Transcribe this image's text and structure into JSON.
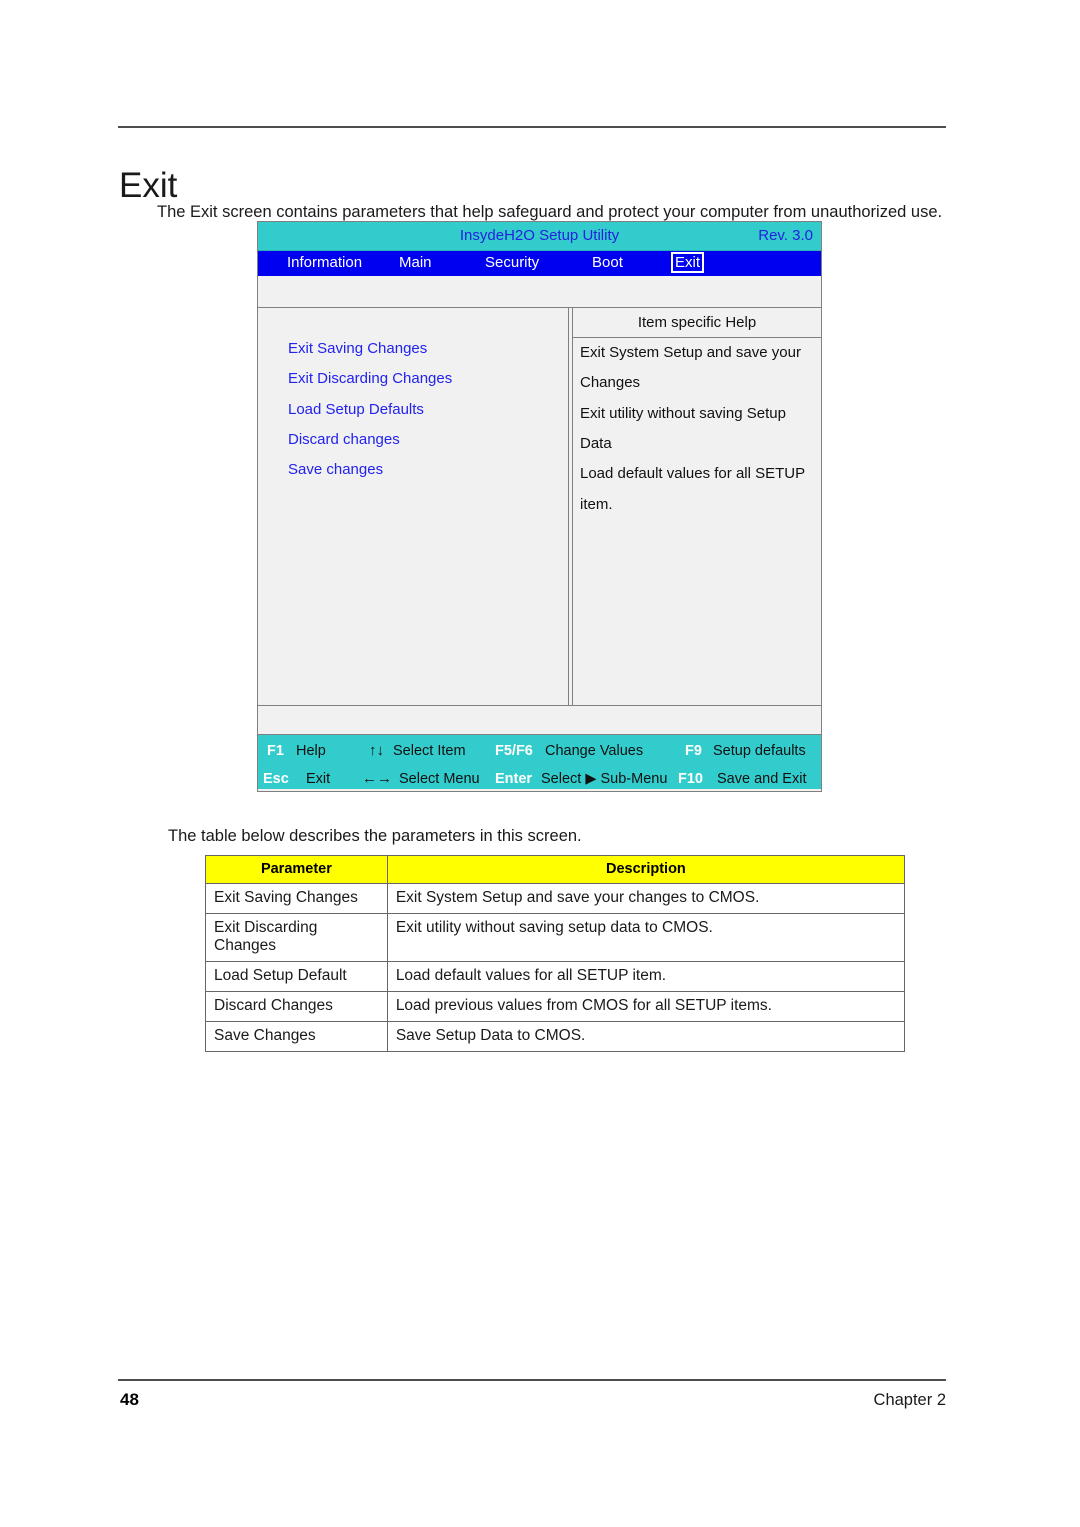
{
  "page": {
    "title": "Exit",
    "intro": "The Exit screen contains parameters that help safeguard and protect your computer from unauthorized use.",
    "table_caption": "The table below describes the parameters in this screen.",
    "footer_page_number": "48",
    "footer_chapter": "Chapter 2"
  },
  "bios": {
    "title": "InsydeH2O Setup Utility",
    "revision": "Rev. 3.0",
    "menu": [
      {
        "label": "Information",
        "selected": false
      },
      {
        "label": "Main",
        "selected": false
      },
      {
        "label": "Security",
        "selected": false
      },
      {
        "label": "Boot",
        "selected": false
      },
      {
        "label": "Exit",
        "selected": true
      }
    ],
    "options": [
      "Exit Saving Changes",
      "Exit Discarding Changes",
      "Load Setup Defaults",
      "Discard changes",
      "Save changes"
    ],
    "help": {
      "heading": "Item specific Help",
      "lines": [
        "Exit System Setup and save your",
        "Changes",
        "Exit utility without saving Setup",
        "Data",
        "Load default values for all SETUP",
        "item."
      ]
    },
    "keybar": [
      {
        "key": "F1",
        "arrows": "",
        "desc": "Help"
      },
      {
        "key": "",
        "arrows": "↑↓",
        "desc": "Select Item"
      },
      {
        "key": "F5/F6",
        "arrows": "",
        "desc": "Change Values"
      },
      {
        "key": "F9",
        "arrows": "",
        "desc": "Setup defaults"
      },
      {
        "key": "Esc",
        "arrows": "",
        "desc": "Exit"
      },
      {
        "key": "",
        "arrows": "←→",
        "desc": "Select Menu"
      },
      {
        "key": "Enter",
        "arrows": "",
        "desc": "Select ▶ Sub-Menu"
      },
      {
        "key": "F10",
        "arrows": "",
        "desc": "Save and Exit"
      }
    ],
    "colors": {
      "titlebar": "#33cccc",
      "menubar": "#0000f0",
      "panel": "#f1f1f1",
      "link_text": "#2222ee",
      "keybar": "#33cccc"
    }
  },
  "param_table": {
    "headers": [
      "Parameter",
      "Description"
    ],
    "header_bg": "#ffff00",
    "rows": [
      {
        "parameter": "Exit Saving Changes",
        "description": "Exit System Setup and save your changes to CMOS."
      },
      {
        "parameter": "Exit Discarding\nChanges",
        "description": "Exit utility without saving setup data to CMOS."
      },
      {
        "parameter": "Load Setup Default",
        "description": "Load default values for all SETUP item."
      },
      {
        "parameter": "Discard Changes",
        "description": "Load previous values from CMOS for all SETUP items."
      },
      {
        "parameter": "Save Changes",
        "description": "Save Setup Data to CMOS."
      }
    ]
  }
}
